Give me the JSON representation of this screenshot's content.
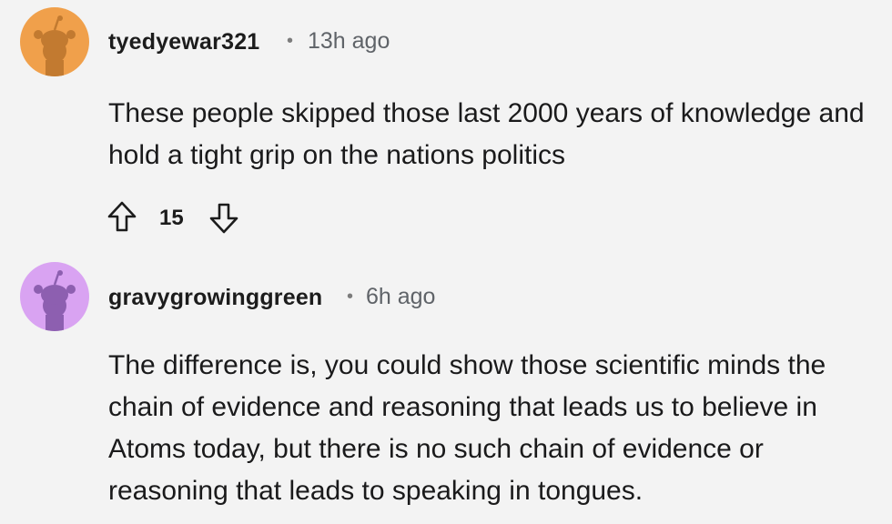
{
  "comments": [
    {
      "username": "tyedyewar321",
      "separator": "•",
      "time": "13h ago",
      "avatar_color": "#f0a04b",
      "body": "These people skipped those last 2000 years of knowledge and hold a tight grip on the nations politics",
      "votes": "15",
      "upvote_icon": "upvote-arrow-icon",
      "downvote_icon": "downvote-arrow-icon"
    },
    {
      "username": "gravygrowinggreen",
      "separator": "•",
      "time": "6h ago",
      "avatar_color": "#d9a3f2",
      "body": "The difference is, you could show those scientific minds the chain of evidence and reasoning that leads us to believe in Atoms today, but there is no such chain of evidence or reasoning that leads to speaking in tongues."
    }
  ]
}
